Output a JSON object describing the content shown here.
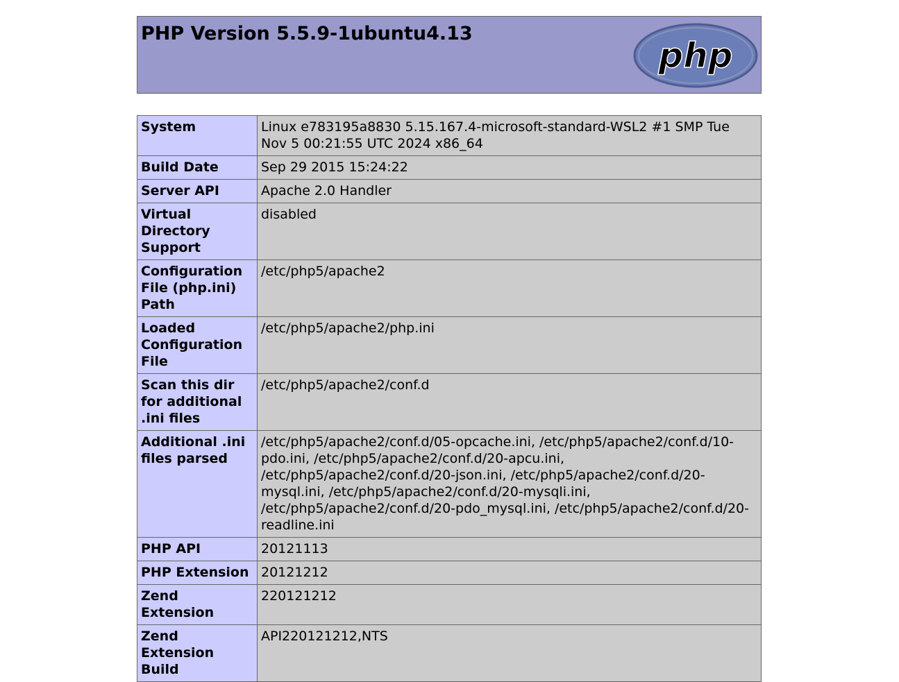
{
  "header": {
    "title": "PHP Version 5.5.9-1ubuntu4.13",
    "logo_text": "php",
    "logo_alt": "PHP Logo",
    "colors": {
      "header_bg": "#9999cc",
      "label_bg": "#ccccff",
      "value_bg": "#cccccc",
      "logo_fill": "#6c7eb7",
      "border": "#666666"
    }
  },
  "rows": [
    {
      "label": "System",
      "value": "Linux e783195a8830 5.15.167.4-microsoft-standard-WSL2 #1 SMP Tue Nov 5 00:21:55 UTC 2024 x86_64"
    },
    {
      "label": "Build Date",
      "value": "Sep 29 2015 15:24:22"
    },
    {
      "label": "Server API",
      "value": "Apache 2.0 Handler"
    },
    {
      "label": "Virtual Directory Support",
      "value": "disabled"
    },
    {
      "label": "Configuration File (php.ini) Path",
      "value": "/etc/php5/apache2"
    },
    {
      "label": "Loaded Configuration File",
      "value": "/etc/php5/apache2/php.ini"
    },
    {
      "label": "Scan this dir for additional .ini files",
      "value": "/etc/php5/apache2/conf.d"
    },
    {
      "label": "Additional .ini files parsed",
      "value": "/etc/php5/apache2/conf.d/05-opcache.ini, /etc/php5/apache2/conf.d/10-pdo.ini, /etc/php5/apache2/conf.d/20-apcu.ini, /etc/php5/apache2/conf.d/20-json.ini, /etc/php5/apache2/conf.d/20-mysql.ini, /etc/php5/apache2/conf.d/20-mysqli.ini, /etc/php5/apache2/conf.d/20-pdo_mysql.ini, /etc/php5/apache2/conf.d/20-readline.ini"
    },
    {
      "label": "PHP API",
      "value": "20121113"
    },
    {
      "label": "PHP Extension",
      "value": "20121212"
    },
    {
      "label": "Zend Extension",
      "value": "220121212"
    },
    {
      "label": "Zend Extension Build",
      "value": "API220121212,NTS"
    }
  ]
}
